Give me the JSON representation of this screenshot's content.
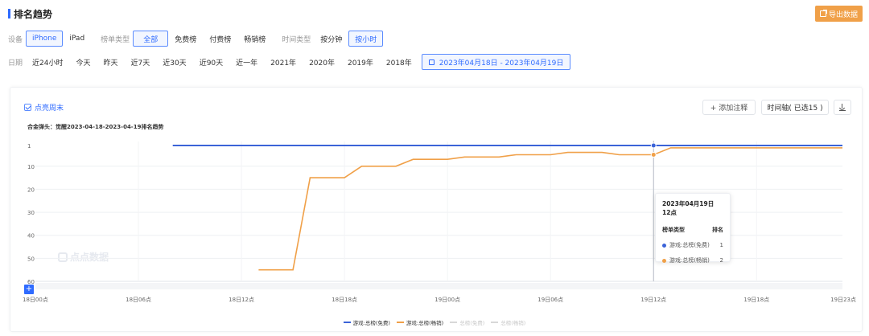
{
  "header": {
    "title": "排名趋势",
    "export_label": "导出数据"
  },
  "filters": {
    "device": {
      "label": "设备",
      "options": [
        "iPhone",
        "iPad"
      ],
      "selected": "iPhone"
    },
    "chart_type": {
      "label": "榜单类型",
      "options": [
        "全部",
        "免费榜",
        "付费榜",
        "畅销榜"
      ],
      "selected": "全部"
    },
    "time_type": {
      "label": "时间类型",
      "options": [
        "按分钟",
        "按小时"
      ],
      "selected": "按小时"
    },
    "date": {
      "label": "日期",
      "options": [
        "近24小时",
        "今天",
        "昨天",
        "近7天",
        "近30天",
        "近90天",
        "近一年",
        "2021年",
        "2020年",
        "2019年",
        "2018年"
      ],
      "range": "2023年04月18日  -  2023年04月19日"
    }
  },
  "toolbar": {
    "weekend_label": "点亮周末",
    "add_note": "+ 添加注释",
    "timeline": "时间轴( 已选15 )"
  },
  "watermark": "点点数据",
  "tooltip": {
    "title": "2023年04月19日 12点",
    "col1": "榜单类型",
    "col2": "排名",
    "rows": [
      {
        "name": "游戏:总榜(免费)",
        "value": "1",
        "color": "#3b63d8"
      },
      {
        "name": "游戏:总榜(畅销)",
        "value": "2",
        "color": "#f0a048"
      }
    ]
  },
  "chart_data": {
    "type": "line",
    "title": "",
    "subtitle": "合金弹头：觉醒2023-04-18-2023-04-19排名趋势",
    "xlabel": "",
    "ylabel": "",
    "x_ticks": [
      "18日00点",
      "18日06点",
      "18日12点",
      "18日18点",
      "19日00点",
      "19日06点",
      "19日12点",
      "19日18点",
      "19日23点"
    ],
    "y_ticks": [
      1,
      10,
      20,
      30,
      40,
      50,
      60
    ],
    "ylim": [
      1,
      60
    ],
    "y_inverted": true,
    "grid": true,
    "legend_position": "bottom",
    "series": [
      {
        "name": "游戏:总榜(免费)",
        "color": "#3b63d8",
        "points": [
          [
            8,
            1
          ],
          [
            9,
            1
          ],
          [
            10,
            1
          ],
          [
            11,
            1
          ],
          [
            12,
            1
          ],
          [
            13,
            1
          ],
          [
            14,
            1
          ],
          [
            15,
            1
          ],
          [
            16,
            1
          ],
          [
            17,
            1
          ],
          [
            18,
            1
          ],
          [
            19,
            1
          ],
          [
            20,
            1
          ],
          [
            21,
            1
          ],
          [
            22,
            1
          ],
          [
            23,
            1
          ],
          [
            24,
            1
          ],
          [
            25,
            1
          ],
          [
            26,
            1
          ],
          [
            27,
            1
          ],
          [
            28,
            1
          ],
          [
            29,
            1
          ],
          [
            30,
            1
          ],
          [
            31,
            1
          ],
          [
            32,
            1
          ],
          [
            33,
            1
          ],
          [
            34,
            1
          ],
          [
            35,
            1
          ],
          [
            36,
            1
          ],
          [
            37,
            1
          ],
          [
            38,
            1
          ],
          [
            39,
            1
          ],
          [
            40,
            1
          ],
          [
            41,
            1
          ],
          [
            42,
            1
          ],
          [
            43,
            1
          ],
          [
            44,
            1
          ],
          [
            45,
            1
          ],
          [
            46,
            1
          ],
          [
            47,
            1
          ]
        ]
      },
      {
        "name": "游戏:总榜(畅销)",
        "color": "#f0a048",
        "points": [
          [
            13,
            55
          ],
          [
            14,
            55
          ],
          [
            15,
            55
          ],
          [
            16,
            15
          ],
          [
            17,
            15
          ],
          [
            18,
            15
          ],
          [
            19,
            10
          ],
          [
            20,
            10
          ],
          [
            21,
            10
          ],
          [
            22,
            7
          ],
          [
            23,
            7
          ],
          [
            24,
            7
          ],
          [
            25,
            6
          ],
          [
            26,
            6
          ],
          [
            27,
            6
          ],
          [
            28,
            5
          ],
          [
            29,
            5
          ],
          [
            30,
            5
          ],
          [
            31,
            4
          ],
          [
            32,
            4
          ],
          [
            33,
            4
          ],
          [
            34,
            5
          ],
          [
            35,
            5
          ],
          [
            36,
            5
          ],
          [
            37,
            2
          ],
          [
            38,
            2
          ],
          [
            39,
            2
          ],
          [
            40,
            2
          ],
          [
            41,
            2
          ],
          [
            42,
            2
          ],
          [
            43,
            2
          ],
          [
            44,
            2
          ],
          [
            45,
            2
          ],
          [
            46,
            2
          ],
          [
            47,
            2
          ]
        ]
      },
      {
        "name": "总榜(免费)",
        "color": "#c8c8c8",
        "points": [],
        "hidden": true
      },
      {
        "name": "总榜(畅销)",
        "color": "#c8c8c8",
        "points": [],
        "hidden": true
      }
    ],
    "x_range": [
      0,
      47
    ],
    "highlight_x": 36
  }
}
